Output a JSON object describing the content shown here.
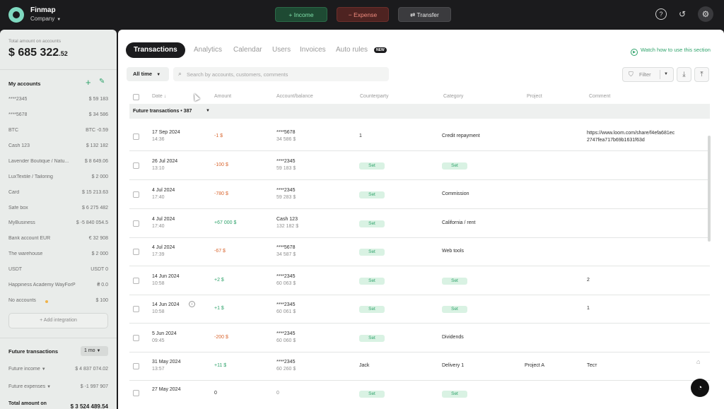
{
  "app": {
    "name": "Finmap",
    "company": "Company"
  },
  "topbar": {
    "income_label": "+ Income",
    "expense_label": "− Expense",
    "transfer_label": "⇄ Transfer",
    "icons": [
      "help-icon",
      "history-icon",
      "settings-icon"
    ]
  },
  "sidebar": {
    "total_label": "Total amount on accounts",
    "total_amount": "$ 685 322",
    "total_cents": ".52",
    "accounts_title": "My accounts",
    "accounts": [
      {
        "name": "****2345",
        "value": "$ 59 183"
      },
      {
        "name": "****5678",
        "value": "$ 34 586"
      },
      {
        "name": "BTC",
        "value": "BTC -0.59"
      },
      {
        "name": "Cash 123",
        "value": "$ 132 182"
      },
      {
        "name": "Lavender Boutique / Natu...",
        "value": "$ 8 649.06"
      },
      {
        "name": "LuxTextile / Tailoring",
        "value": "$ 2 000"
      },
      {
        "name": "Card",
        "value": "$ 15 213.63"
      },
      {
        "name": "Safe box",
        "value": "$ 6 275 482"
      },
      {
        "name": "MyBusiness",
        "value": "$ -5 840 054.5"
      },
      {
        "name": "Bank account EUR",
        "value": "€ 32 908"
      },
      {
        "name": "The warehouse",
        "value": "$ 2 000"
      },
      {
        "name": "USDT",
        "value": "USDT 0"
      },
      {
        "name": "Happiness Academy WayForPay",
        "value": "₴ 0.0"
      },
      {
        "name": "No accounts",
        "value": "$ 100"
      }
    ],
    "add_integration": "+ Add integration",
    "future_title": "Future transactions",
    "future_period": "1 mo",
    "future_income_label": "Future income",
    "future_income_value": "$ 4 837 074.02",
    "future_expenses_label": "Future expenses",
    "future_expenses_value": "$ -1 997 907",
    "future_total_label": "Total amount on",
    "future_total_value": "$ 3 524 489.54"
  },
  "main": {
    "tabs": [
      "Transactions",
      "Analytics",
      "Calendar",
      "Users",
      "Invoices",
      "Auto rules"
    ],
    "new_badge": "NEW",
    "watch_link": "Watch how to use this section",
    "period_select": "All time",
    "search_placeholder": "Search by accounts, customers, comments",
    "filter_label": "Filter",
    "columns": [
      "Date ↓",
      "Amount",
      "Account/balance",
      "Counterparty",
      "Category",
      "Project",
      "Comment"
    ],
    "group_label": "Future transactions • 387",
    "set_label": "Set",
    "rows": [
      {
        "date": "17 Sep 2024",
        "time": "14:36",
        "amount": "-1 $",
        "sign": "neg",
        "account": "****5678",
        "balance": "34 586 $",
        "counterparty": "1",
        "category": "Credit repayment",
        "project": "",
        "comment": "https://www.loom.com/share/f4efa681ec 2747fea717b69b1631f63d"
      },
      {
        "date": "26 Jul 2024",
        "time": "13:10",
        "amount": "-100 $",
        "sign": "neg",
        "account": "****2345",
        "balance": "59 183 $",
        "counterparty": "",
        "category": "",
        "project": "",
        "comment": ""
      },
      {
        "date": "4 Jul 2024",
        "time": "17:40",
        "amount": "-780 $",
        "sign": "neg",
        "account": "****2345",
        "balance": "59 283 $",
        "counterparty": "",
        "category": "Commission",
        "project": "",
        "comment": ""
      },
      {
        "date": "4 Jul 2024",
        "time": "17:40",
        "amount": "+67 000 $",
        "sign": "pos",
        "account": "Cash 123",
        "balance": "132 182 $",
        "counterparty": "",
        "category": "California / rent",
        "project": "",
        "comment": ""
      },
      {
        "date": "4 Jul 2024",
        "time": "17:39",
        "amount": "-67 $",
        "sign": "neg",
        "account": "****5678",
        "balance": "34 587 $",
        "counterparty": "",
        "category": "Web tools",
        "project": "",
        "comment": ""
      },
      {
        "date": "14 Jun 2024",
        "time": "10:58",
        "amount": "+2 $",
        "sign": "pos",
        "account": "****2345",
        "balance": "60 063 $",
        "counterparty": "",
        "category": "",
        "project": "",
        "comment": "2"
      },
      {
        "date": "14 Jun 2024",
        "time": "10:58",
        "amount": "+1 $",
        "sign": "pos",
        "account": "****2345",
        "balance": "60 061 $",
        "counterparty": "",
        "category": "",
        "project": "",
        "comment": "1"
      },
      {
        "date": "5 Jun 2024",
        "time": "09:45",
        "amount": "-200 $",
        "sign": "neg",
        "account": "****2345",
        "balance": "60 060 $",
        "counterparty": "",
        "category": "Dividends",
        "project": "",
        "comment": ""
      },
      {
        "date": "31 May 2024",
        "time": "13:57",
        "amount": "+11 $",
        "sign": "pos",
        "account": "****2345",
        "balance": "60 260 $",
        "counterparty": "Jack",
        "category": "Delivery 1",
        "project": "Project A",
        "comment": "Тест"
      },
      {
        "date": "27 May 2024",
        "time": "",
        "amount": "0",
        "sign": "zero",
        "account": "0",
        "balance": "",
        "counterparty": "",
        "category": "",
        "project": "",
        "comment": ""
      }
    ]
  },
  "colors": {
    "income": "#2fa36b",
    "expense": "#d9662f",
    "dark": "#1c1c1e"
  }
}
